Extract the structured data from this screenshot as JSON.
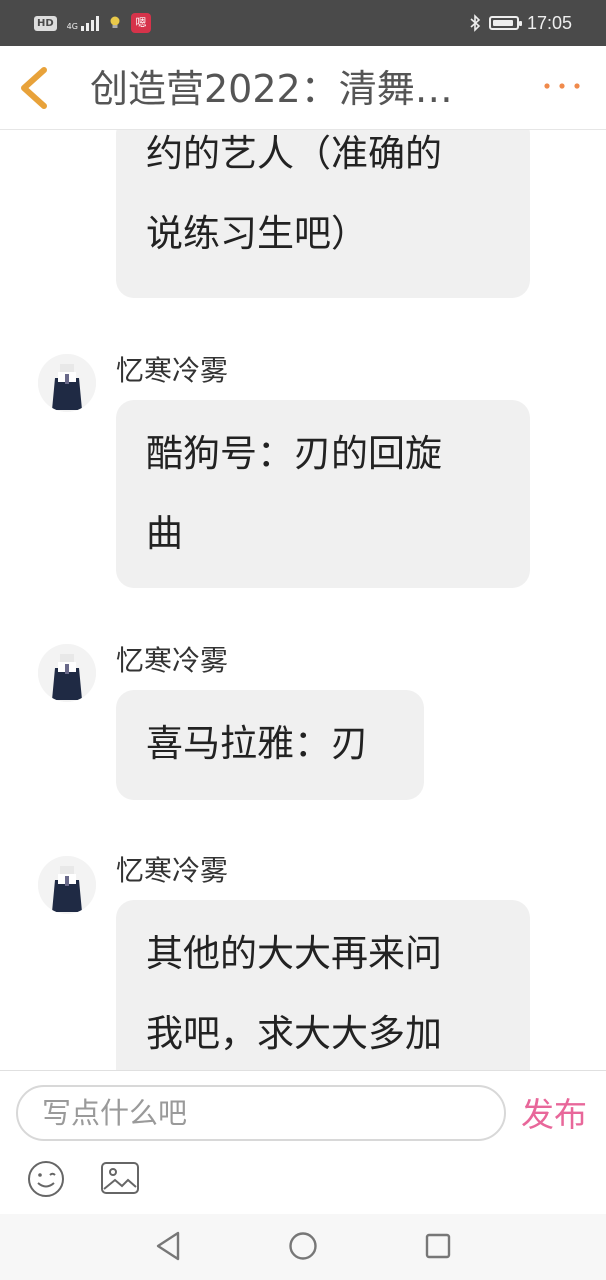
{
  "status_bar": {
    "hd_badge": "HD",
    "network_label": "4G",
    "app_badge": "嗯",
    "time": "17:05",
    "battery_level": 0.9,
    "icons": [
      "hd-icon",
      "signal-icon",
      "lightbulb-icon",
      "app-notification-icon",
      "bluetooth-icon",
      "battery-icon"
    ]
  },
  "header": {
    "title": "创造营2022：清舞…",
    "back_icon": "chevron-left-icon",
    "more_icon": "more-dots-icon",
    "accent_color": "#e8a23a"
  },
  "messages": [
    {
      "sender": "",
      "lines": [
        "约的艺人（准确的",
        "说练习生吧）"
      ]
    },
    {
      "sender": "忆寒冷雾",
      "lines": [
        "酷狗号：刃的回旋",
        "曲"
      ]
    },
    {
      "sender": "忆寒冷雾",
      "lines": [
        "喜马拉雅：刃"
      ]
    },
    {
      "sender": "忆寒冷雾",
      "lines": [
        "其他的大大再来问",
        "我吧，求大大多加"
      ]
    }
  ],
  "input_bar": {
    "placeholder": "写点什么吧",
    "value": "",
    "publish_label": "发布",
    "publish_color": "#e8679a",
    "emoji_icon": "emoji-icon",
    "image_icon": "image-icon"
  },
  "nav_bar": {
    "icons": [
      "nav-back-triangle-icon",
      "nav-home-circle-icon",
      "nav-recent-square-icon"
    ]
  }
}
